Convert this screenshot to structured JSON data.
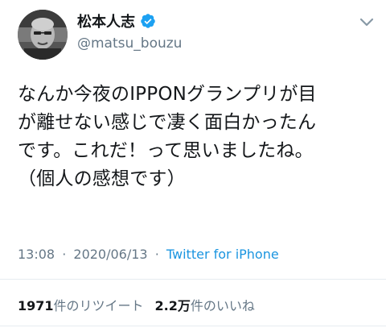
{
  "author": {
    "display_name": "松本人志",
    "handle": "@matsu_bouzu",
    "verified_icon": "verified-badge-icon",
    "avatar_icon": "profile-photo"
  },
  "menu_icon": "chevron-down-icon",
  "tweet": {
    "lines": [
      "なんか今夜のIPPONグランプリが目",
      "が離せない感じで凄く面白かったん",
      "です。これだ！って思いましたね。",
      "（個人の感想です）"
    ]
  },
  "meta": {
    "time": "13:08",
    "separator": "·",
    "date": "2020/06/13",
    "source": "Twitter for iPhone"
  },
  "stats": {
    "retweets_count": "1971",
    "retweets_label": "件のリツイート",
    "likes_count": "2.2万",
    "likes_label": "件のいいね"
  },
  "colors": {
    "text": "#14171a",
    "secondary": "#657786",
    "link": "#1b95e0",
    "verified": "#1da1f2",
    "divider": "#e6ecf0"
  }
}
